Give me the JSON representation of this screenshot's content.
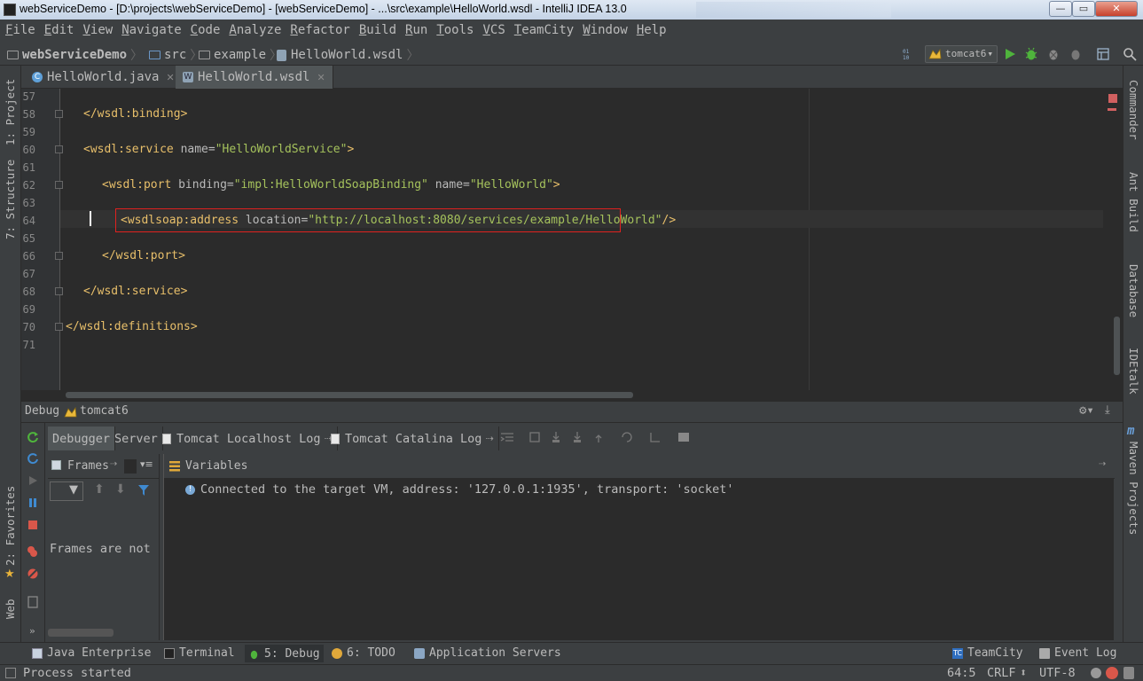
{
  "window": {
    "title": "webServiceDemo - [D:\\projects\\webServiceDemo] - [webServiceDemo] - ...\\src\\example\\HelloWorld.wsdl - IntelliJ IDEA 13.0",
    "minimize": "—",
    "maximize": "▭",
    "close": "✕"
  },
  "menu": [
    "File",
    "Edit",
    "View",
    "Navigate",
    "Code",
    "Analyze",
    "Refactor",
    "Build",
    "Run",
    "Tools",
    "VCS",
    "TeamCity",
    "Window",
    "Help"
  ],
  "breadcrumb": {
    "project": "webServiceDemo",
    "src": "src",
    "example": "example",
    "file": "HelloWorld.wsdl"
  },
  "run_config": "tomcat6",
  "tabs": [
    {
      "label": "HelloWorld.java",
      "icon": "C"
    },
    {
      "label": "HelloWorld.wsdl",
      "icon": "W"
    }
  ],
  "left_tool_tabs": {
    "project": "1: Project",
    "structure": "7: Structure",
    "favorites": "2: Favorites",
    "web": "Web"
  },
  "right_tool_tabs": {
    "commander": "Commander",
    "ant": "Ant Build",
    "database": "Database",
    "idetalk": "IDEtalk",
    "maven": "Maven Projects"
  },
  "editor": {
    "line_numbers": [
      "57",
      "58",
      "59",
      "60",
      "61",
      "62",
      "63",
      "64",
      "65",
      "66",
      "67",
      "68",
      "69",
      "70",
      "71"
    ],
    "lines": {
      "l58": "</wsdl:binding>",
      "l60_open": "<wsdl:service",
      "l60_attr": " name=",
      "l60_val": "\"HelloWorldService\"",
      "l60_close": ">",
      "l62_open": "<wsdl:port",
      "l62_attr1": " binding=",
      "l62_val1": "\"impl:HelloWorldSoapBinding\"",
      "l62_attr2": " name=",
      "l62_val2": "\"HelloWorld\"",
      "l62_close": ">",
      "l64_open": "<wsdlsoap:address",
      "l64_attr": " location=",
      "l64_val": "\"http://localhost:8080/services/example/HelloWorld\"",
      "l64_close": "/>",
      "l66": "</wsdl:port>",
      "l68": "</wsdl:service>",
      "l70": "</wsdl:definitions>"
    }
  },
  "debug": {
    "header_label": "Debug",
    "config": "tomcat6",
    "tabs": [
      "Debugger",
      "Server",
      "Tomcat Localhost Log",
      "Tomcat Catalina Log"
    ],
    "frames_label": "Frames",
    "frames_message": "Frames are not",
    "variables_label": "Variables",
    "console_message": "Connected to the target VM, address: '127.0.0.1:1935', transport: 'socket'"
  },
  "tool_windows": [
    {
      "label": "Java Enterprise"
    },
    {
      "label": "Terminal"
    },
    {
      "label": "5: Debug"
    },
    {
      "label": "6: TODO"
    },
    {
      "label": "Application Servers"
    },
    {
      "label": "TeamCity"
    },
    {
      "label": "Event Log"
    }
  ],
  "status": {
    "message": "Process started",
    "position": "64:5",
    "line_sep": "CRLF",
    "encoding": "UTF-8"
  }
}
